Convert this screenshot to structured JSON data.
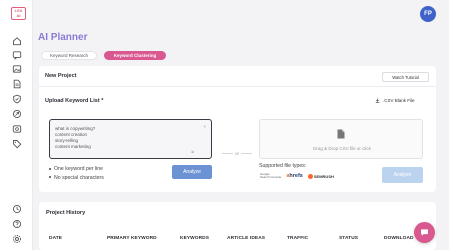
{
  "logo_text": "LSX AI",
  "avatar_initials": "FP",
  "page_title": "AI Planner",
  "tabs": [
    {
      "label": "Keyword Research"
    },
    {
      "label": "Keyword Clustering"
    }
  ],
  "new_project": {
    "title": "New Project",
    "watch_tutorial": "Watch Tutorial"
  },
  "upload": {
    "title": "Upload Keyword List *",
    "csv_blank": ".CSV Blank File",
    "textarea_lines": [
      "what is copywriting?",
      "content creation",
      "story-telling",
      "content marketing"
    ],
    "or_label": "or",
    "dropzone_text": "Drag & Drop CSV file or click",
    "bullets": [
      "One keyword per line",
      "No special characters"
    ],
    "analyze_label": "Analyze",
    "supported_label": "Supported file types:",
    "brands": {
      "google": "Google Search Console",
      "ahrefs": "ahrefs",
      "semrush": "SEMRUSH"
    },
    "analyze_label_2": "Analyze"
  },
  "history": {
    "title": "Project History",
    "columns": [
      "DATE",
      "PRIMARY KEYWORD",
      "KEYWORDS",
      "ARTICLE IDEAS",
      "TRAFFIC",
      "STATUS",
      "DOWNLOAD"
    ]
  },
  "colors": {
    "accent": "#d9588f",
    "title": "#8b7bd6",
    "button": "#6b93d3",
    "button_disabled": "#bcd3ef",
    "avatar": "#3f63c9"
  }
}
